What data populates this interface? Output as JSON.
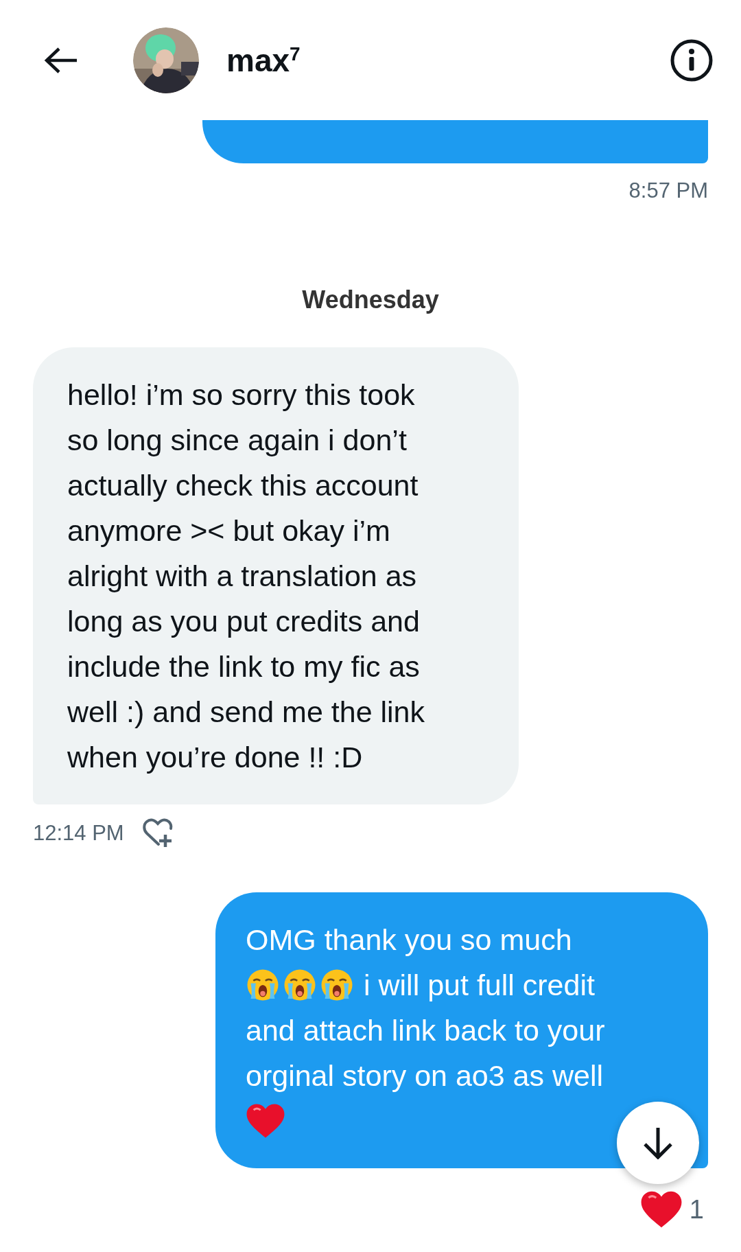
{
  "header": {
    "name": "max",
    "name_superscript": "7"
  },
  "messages": [
    {
      "kind": "sent",
      "cut_off": true,
      "time": "8:57 PM"
    },
    {
      "kind": "divider",
      "label": "Wednesday"
    },
    {
      "kind": "received",
      "parts": [
        {
          "kind": "text",
          "text": "hello! i’m so sorry this took so long since again i don’t actually check this account anymore >< but okay i’m alright with a translation as long as you put credits and include the link to my fic as well :) and send me the link when you’re done !! :D"
        }
      ],
      "time": "12:14 PM"
    },
    {
      "kind": "sent",
      "cut_off": false,
      "lines": [
        {
          "parts": [
            {
              "kind": "text",
              "text": "OMG thank you so much"
            }
          ]
        },
        {
          "parts": [
            {
              "kind": "sob"
            },
            {
              "kind": "sob"
            },
            {
              "kind": "sob"
            },
            {
              "kind": "text",
              "text": "i will put full credit"
            }
          ]
        },
        {
          "parts": [
            {
              "kind": "text",
              "text": "and attach link back to your"
            }
          ]
        },
        {
          "parts": [
            {
              "kind": "text",
              "text": "orginal story on ao3 as well"
            }
          ]
        },
        {
          "parts": [
            {
              "kind": "heart"
            }
          ]
        }
      ],
      "reaction_count": "1"
    }
  ]
}
